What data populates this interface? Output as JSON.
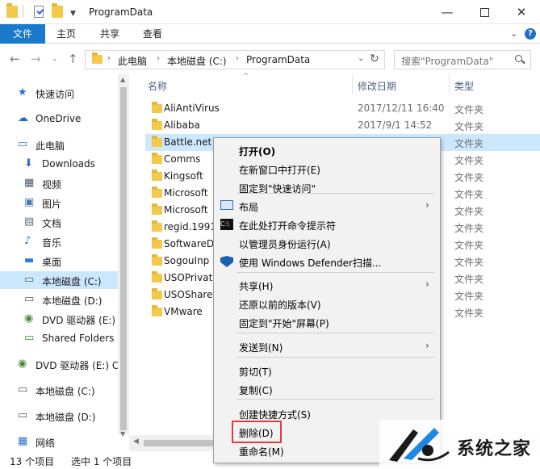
{
  "window": {
    "title": "ProgramData",
    "min_glyph": "—",
    "close_glyph": "✕"
  },
  "ribbon": {
    "tabs": [
      "文件",
      "主页",
      "共享",
      "查看"
    ],
    "help_glyph": "?"
  },
  "address": {
    "crumbs": [
      "此电脑",
      "本地磁盘 (C:)",
      "ProgramData"
    ],
    "search_placeholder": "搜索\"ProgramData\""
  },
  "nav": {
    "items": [
      {
        "label": "快速访问",
        "icon": "star-icon"
      },
      {
        "label": "OneDrive",
        "icon": "cloud-icon"
      },
      {
        "label": "此电脑",
        "icon": "computer-icon"
      },
      {
        "label": "Downloads",
        "icon": "download-icon"
      },
      {
        "label": "视频",
        "icon": "video-icon"
      },
      {
        "label": "图片",
        "icon": "picture-icon"
      },
      {
        "label": "文档",
        "icon": "document-icon"
      },
      {
        "label": "音乐",
        "icon": "music-icon"
      },
      {
        "label": "桌面",
        "icon": "desktop-icon"
      },
      {
        "label": "本地磁盘 (C:)",
        "icon": "drive-icon",
        "selected": true
      },
      {
        "label": "本地磁盘 (D:)",
        "icon": "drive-icon"
      },
      {
        "label": "DVD 驱动器 (E:)",
        "icon": "dvd-icon"
      },
      {
        "label": "Shared Folders",
        "icon": "network-drive-icon"
      },
      {
        "label": "DVD 驱动器 (E:) C",
        "icon": "dvd-icon"
      },
      {
        "label": "本地磁盘 (C:)",
        "icon": "drive-icon"
      },
      {
        "label": "本地磁盘 (D:)",
        "icon": "drive-icon"
      },
      {
        "label": "网络",
        "icon": "network-icon"
      }
    ]
  },
  "columns": {
    "name": "名称",
    "date": "修改日期",
    "type": "类型"
  },
  "files": [
    {
      "name": "AliAntiVirus",
      "date": "2017/12/11 16:40",
      "type": "文件夹"
    },
    {
      "name": "Alibaba",
      "date": "2017/9/1 14:52",
      "type": "文件夹"
    },
    {
      "name": "Battle.net",
      "date": "",
      "type": "文件夹",
      "highlight": true
    },
    {
      "name": "Comms",
      "date": "",
      "type": "文件夹"
    },
    {
      "name": "Kingsoft",
      "date": "",
      "type": "文件夹"
    },
    {
      "name": "Microsoft",
      "date": "",
      "type": "文件夹"
    },
    {
      "name": "Microsoft",
      "date": "",
      "type": "文件夹"
    },
    {
      "name": "regid.1991",
      "date": "",
      "type": "文件夹"
    },
    {
      "name": "SoftwareD",
      "date": "",
      "type": "文件夹"
    },
    {
      "name": "SogouInp",
      "date": "",
      "type": "文件夹"
    },
    {
      "name": "USOPrivat",
      "date": "",
      "type": "文件夹"
    },
    {
      "name": "USOShare",
      "date": "",
      "type": "文件夹"
    },
    {
      "name": "VMware",
      "date": "",
      "type": "文件夹"
    }
  ],
  "context_menu": {
    "items": [
      {
        "label": "打开(O)",
        "bold": true
      },
      {
        "label": "在新窗口中打开(E)"
      },
      {
        "label": "固定到\"快速访问\""
      },
      {
        "label": "布局",
        "submenu": true,
        "icon": "layout-icon"
      },
      {
        "label": "在此处打开命令提示符",
        "icon": "cmd-icon"
      },
      {
        "label": "以管理员身份运行(A)"
      },
      {
        "label": "使用 Windows Defender扫描...",
        "icon": "defender-shield-icon"
      },
      {
        "label": "共享(H)",
        "submenu": true
      },
      {
        "label": "还原以前的版本(V)"
      },
      {
        "label": "固定到\"开始\"屏幕(P)"
      },
      {
        "label": "发送到(N)",
        "submenu": true
      },
      {
        "label": "剪切(T)"
      },
      {
        "label": "复制(C)"
      },
      {
        "label": "创建快捷方式(S)"
      },
      {
        "label": "删除(D)"
      },
      {
        "label": "重命名(M)"
      }
    ]
  },
  "status": {
    "count": "13 个项目",
    "selected": "选中 1 个项目"
  },
  "watermark": {
    "text": "系统之家"
  }
}
